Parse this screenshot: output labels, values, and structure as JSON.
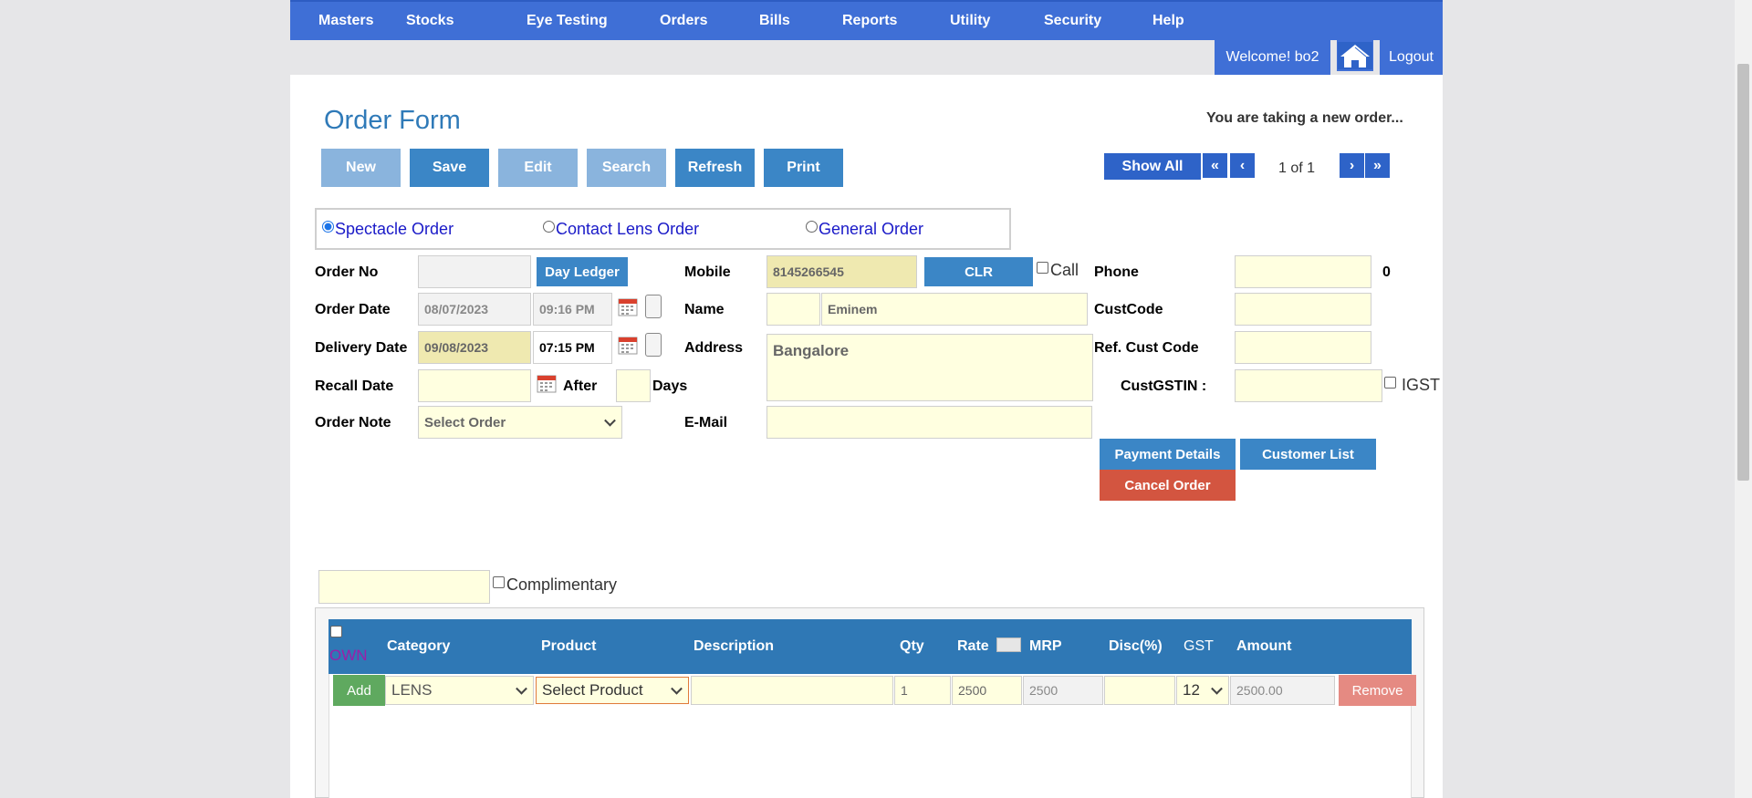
{
  "nav": {
    "items": [
      "Masters",
      "Stocks",
      "Eye Testing",
      "Orders",
      "Bills",
      "Reports",
      "Utility",
      "Security",
      "Help"
    ],
    "welcome": "Welcome! bo2",
    "logout": "Logout"
  },
  "page": {
    "title": "Order Form",
    "status": "You are taking a new order..."
  },
  "toolbar": {
    "new": "New",
    "save": "Save",
    "edit": "Edit",
    "search": "Search",
    "refresh": "Refresh",
    "print": "Print"
  },
  "pager": {
    "show_all": "Show All",
    "first": "«",
    "prev": "‹",
    "next": "›",
    "last": "»",
    "info": "1 of 1"
  },
  "order_type": {
    "options": [
      "Spectacle Order",
      "Contact Lens Order",
      "General Order"
    ],
    "selected": "Spectacle Order"
  },
  "form": {
    "order_no_label": "Order No",
    "day_ledger": "Day Ledger",
    "order_date_label": "Order Date",
    "order_date": "08/07/2023",
    "order_time": "09:16 PM",
    "delivery_date_label": "Delivery Date",
    "delivery_date": "09/08/2023",
    "delivery_time": "07:15 PM",
    "recall_date_label": "Recall Date",
    "after_label": "After",
    "days_label": "Days",
    "order_note_label": "Order Note",
    "order_note_value": "Select Order",
    "mobile_label": "Mobile",
    "mobile_value": "8145266545",
    "clr": "CLR",
    "call_label": "Call",
    "name_label": "Name",
    "name_value": "Eminem",
    "address_label": "Address",
    "address_value": "Bangalore",
    "email_label": "E-Mail",
    "phone_label": "Phone",
    "phone_count": "0",
    "custcode_label": "CustCode",
    "ref_cust_label": "Ref. Cust Code",
    "gstin_label": "CustGSTIN :",
    "igst_label": "IGST",
    "payment_details": "Payment Details",
    "customer_list": "Customer List",
    "cancel_order": "Cancel Order",
    "complimentary_label": "Complimentary"
  },
  "grid": {
    "headers": {
      "own": "OWN",
      "category": "Category",
      "product": "Product",
      "description": "Description",
      "qty": "Qty",
      "rate": "Rate",
      "mrp": "MRP",
      "disc": "Disc(%)",
      "gst": "GST",
      "amount": "Amount"
    },
    "row": {
      "add": "Add",
      "category": "LENS",
      "product": "Select Product",
      "qty": "1",
      "rate": "2500",
      "mrp": "2500",
      "gst": "12",
      "amount": "2500.00",
      "remove": "Remove"
    }
  }
}
